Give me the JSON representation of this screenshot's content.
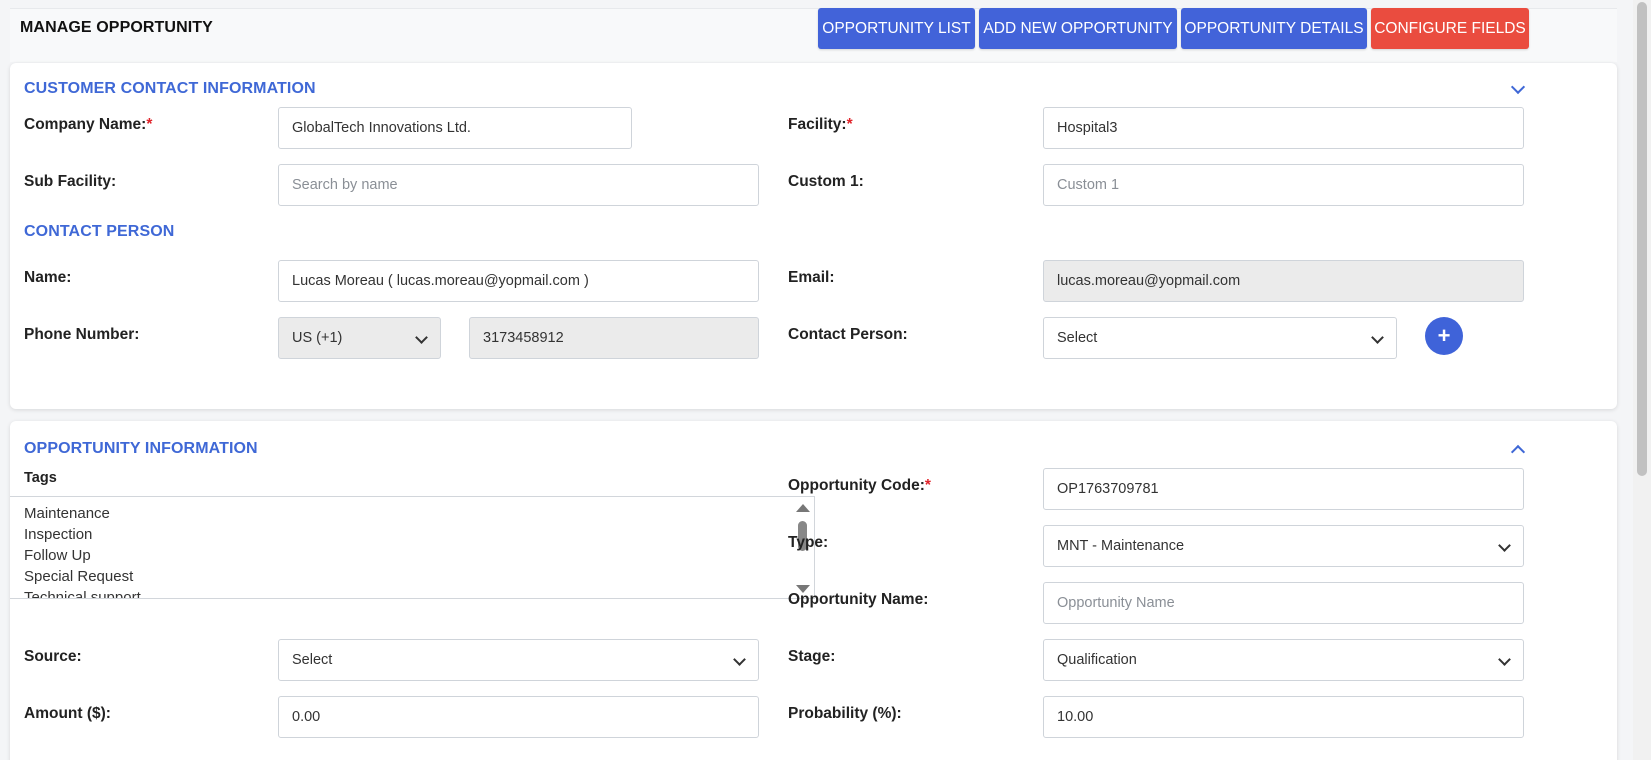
{
  "header": {
    "title": "MANAGE OPPORTUNITY",
    "buttons": {
      "list": "OPPORTUNITY LIST",
      "add": "ADD NEW OPPORTUNITY",
      "details": "OPPORTUNITY DETAILS",
      "configure": "CONFIGURE FIELDS"
    }
  },
  "customer": {
    "section_title": "CUSTOMER CONTACT INFORMATION",
    "company_label": "Company Name:",
    "company_value": "GlobalTech Innovations Ltd.",
    "facility_label": "Facility:",
    "facility_value": "Hospital3",
    "sub_facility_label": "Sub Facility:",
    "sub_facility_placeholder": "Search by name",
    "custom1_label": "Custom 1:",
    "custom1_placeholder": "Custom 1"
  },
  "contact": {
    "section_title": "CONTACT PERSON",
    "name_label": "Name:",
    "name_value": "Lucas Moreau ( lucas.moreau@yopmail.com )",
    "email_label": "Email:",
    "email_value": "lucas.moreau@yopmail.com",
    "phone_label": "Phone Number:",
    "country_code": "US (+1)",
    "phone_value": "3173458912",
    "contact_person_label": "Contact Person:",
    "contact_person_value": "Select",
    "add_icon": "plus-icon"
  },
  "opportunity": {
    "section_title": "OPPORTUNITY INFORMATION",
    "tags_label": "Tags",
    "tags": [
      "Maintenance",
      "Inspection",
      "Follow Up",
      "Special Request",
      "Technical support"
    ],
    "code_label": "Opportunity Code:",
    "code_value": "OP1763709781",
    "type_label": "Type:",
    "type_value": "MNT - Maintenance",
    "name_label": "Opportunity Name:",
    "name_placeholder": "Opportunity Name",
    "source_label": "Source:",
    "source_value": "Select",
    "stage_label": "Stage:",
    "stage_value": "Qualification",
    "amount_label": "Amount ($):",
    "amount_value": "0.00",
    "probability_label": "Probability (%):",
    "probability_value": "10.00"
  },
  "colors": {
    "primary": "#4263d9",
    "danger": "#ea4c3f",
    "section_title": "#3f68d6",
    "required": "#e0242b"
  }
}
